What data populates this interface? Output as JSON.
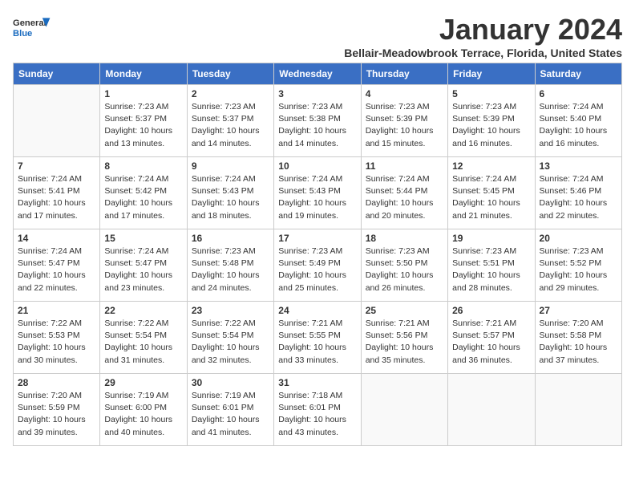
{
  "header": {
    "logo_general": "General",
    "logo_blue": "Blue",
    "month_title": "January 2024",
    "subtitle": "Bellair-Meadowbrook Terrace, Florida, United States"
  },
  "weekdays": [
    "Sunday",
    "Monday",
    "Tuesday",
    "Wednesday",
    "Thursday",
    "Friday",
    "Saturday"
  ],
  "weeks": [
    [
      {
        "day": "",
        "sunrise": "",
        "sunset": "",
        "daylight": ""
      },
      {
        "day": "1",
        "sunrise": "Sunrise: 7:23 AM",
        "sunset": "Sunset: 5:37 PM",
        "daylight": "Daylight: 10 hours and 13 minutes."
      },
      {
        "day": "2",
        "sunrise": "Sunrise: 7:23 AM",
        "sunset": "Sunset: 5:37 PM",
        "daylight": "Daylight: 10 hours and 14 minutes."
      },
      {
        "day": "3",
        "sunrise": "Sunrise: 7:23 AM",
        "sunset": "Sunset: 5:38 PM",
        "daylight": "Daylight: 10 hours and 14 minutes."
      },
      {
        "day": "4",
        "sunrise": "Sunrise: 7:23 AM",
        "sunset": "Sunset: 5:39 PM",
        "daylight": "Daylight: 10 hours and 15 minutes."
      },
      {
        "day": "5",
        "sunrise": "Sunrise: 7:23 AM",
        "sunset": "Sunset: 5:39 PM",
        "daylight": "Daylight: 10 hours and 16 minutes."
      },
      {
        "day": "6",
        "sunrise": "Sunrise: 7:24 AM",
        "sunset": "Sunset: 5:40 PM",
        "daylight": "Daylight: 10 hours and 16 minutes."
      }
    ],
    [
      {
        "day": "7",
        "sunrise": "Sunrise: 7:24 AM",
        "sunset": "Sunset: 5:41 PM",
        "daylight": "Daylight: 10 hours and 17 minutes."
      },
      {
        "day": "8",
        "sunrise": "Sunrise: 7:24 AM",
        "sunset": "Sunset: 5:42 PM",
        "daylight": "Daylight: 10 hours and 17 minutes."
      },
      {
        "day": "9",
        "sunrise": "Sunrise: 7:24 AM",
        "sunset": "Sunset: 5:43 PM",
        "daylight": "Daylight: 10 hours and 18 minutes."
      },
      {
        "day": "10",
        "sunrise": "Sunrise: 7:24 AM",
        "sunset": "Sunset: 5:43 PM",
        "daylight": "Daylight: 10 hours and 19 minutes."
      },
      {
        "day": "11",
        "sunrise": "Sunrise: 7:24 AM",
        "sunset": "Sunset: 5:44 PM",
        "daylight": "Daylight: 10 hours and 20 minutes."
      },
      {
        "day": "12",
        "sunrise": "Sunrise: 7:24 AM",
        "sunset": "Sunset: 5:45 PM",
        "daylight": "Daylight: 10 hours and 21 minutes."
      },
      {
        "day": "13",
        "sunrise": "Sunrise: 7:24 AM",
        "sunset": "Sunset: 5:46 PM",
        "daylight": "Daylight: 10 hours and 22 minutes."
      }
    ],
    [
      {
        "day": "14",
        "sunrise": "Sunrise: 7:24 AM",
        "sunset": "Sunset: 5:47 PM",
        "daylight": "Daylight: 10 hours and 22 minutes."
      },
      {
        "day": "15",
        "sunrise": "Sunrise: 7:24 AM",
        "sunset": "Sunset: 5:47 PM",
        "daylight": "Daylight: 10 hours and 23 minutes."
      },
      {
        "day": "16",
        "sunrise": "Sunrise: 7:23 AM",
        "sunset": "Sunset: 5:48 PM",
        "daylight": "Daylight: 10 hours and 24 minutes."
      },
      {
        "day": "17",
        "sunrise": "Sunrise: 7:23 AM",
        "sunset": "Sunset: 5:49 PM",
        "daylight": "Daylight: 10 hours and 25 minutes."
      },
      {
        "day": "18",
        "sunrise": "Sunrise: 7:23 AM",
        "sunset": "Sunset: 5:50 PM",
        "daylight": "Daylight: 10 hours and 26 minutes."
      },
      {
        "day": "19",
        "sunrise": "Sunrise: 7:23 AM",
        "sunset": "Sunset: 5:51 PM",
        "daylight": "Daylight: 10 hours and 28 minutes."
      },
      {
        "day": "20",
        "sunrise": "Sunrise: 7:23 AM",
        "sunset": "Sunset: 5:52 PM",
        "daylight": "Daylight: 10 hours and 29 minutes."
      }
    ],
    [
      {
        "day": "21",
        "sunrise": "Sunrise: 7:22 AM",
        "sunset": "Sunset: 5:53 PM",
        "daylight": "Daylight: 10 hours and 30 minutes."
      },
      {
        "day": "22",
        "sunrise": "Sunrise: 7:22 AM",
        "sunset": "Sunset: 5:54 PM",
        "daylight": "Daylight: 10 hours and 31 minutes."
      },
      {
        "day": "23",
        "sunrise": "Sunrise: 7:22 AM",
        "sunset": "Sunset: 5:54 PM",
        "daylight": "Daylight: 10 hours and 32 minutes."
      },
      {
        "day": "24",
        "sunrise": "Sunrise: 7:21 AM",
        "sunset": "Sunset: 5:55 PM",
        "daylight": "Daylight: 10 hours and 33 minutes."
      },
      {
        "day": "25",
        "sunrise": "Sunrise: 7:21 AM",
        "sunset": "Sunset: 5:56 PM",
        "daylight": "Daylight: 10 hours and 35 minutes."
      },
      {
        "day": "26",
        "sunrise": "Sunrise: 7:21 AM",
        "sunset": "Sunset: 5:57 PM",
        "daylight": "Daylight: 10 hours and 36 minutes."
      },
      {
        "day": "27",
        "sunrise": "Sunrise: 7:20 AM",
        "sunset": "Sunset: 5:58 PM",
        "daylight": "Daylight: 10 hours and 37 minutes."
      }
    ],
    [
      {
        "day": "28",
        "sunrise": "Sunrise: 7:20 AM",
        "sunset": "Sunset: 5:59 PM",
        "daylight": "Daylight: 10 hours and 39 minutes."
      },
      {
        "day": "29",
        "sunrise": "Sunrise: 7:19 AM",
        "sunset": "Sunset: 6:00 PM",
        "daylight": "Daylight: 10 hours and 40 minutes."
      },
      {
        "day": "30",
        "sunrise": "Sunrise: 7:19 AM",
        "sunset": "Sunset: 6:01 PM",
        "daylight": "Daylight: 10 hours and 41 minutes."
      },
      {
        "day": "31",
        "sunrise": "Sunrise: 7:18 AM",
        "sunset": "Sunset: 6:01 PM",
        "daylight": "Daylight: 10 hours and 43 minutes."
      },
      {
        "day": "",
        "sunrise": "",
        "sunset": "",
        "daylight": ""
      },
      {
        "day": "",
        "sunrise": "",
        "sunset": "",
        "daylight": ""
      },
      {
        "day": "",
        "sunrise": "",
        "sunset": "",
        "daylight": ""
      }
    ]
  ]
}
